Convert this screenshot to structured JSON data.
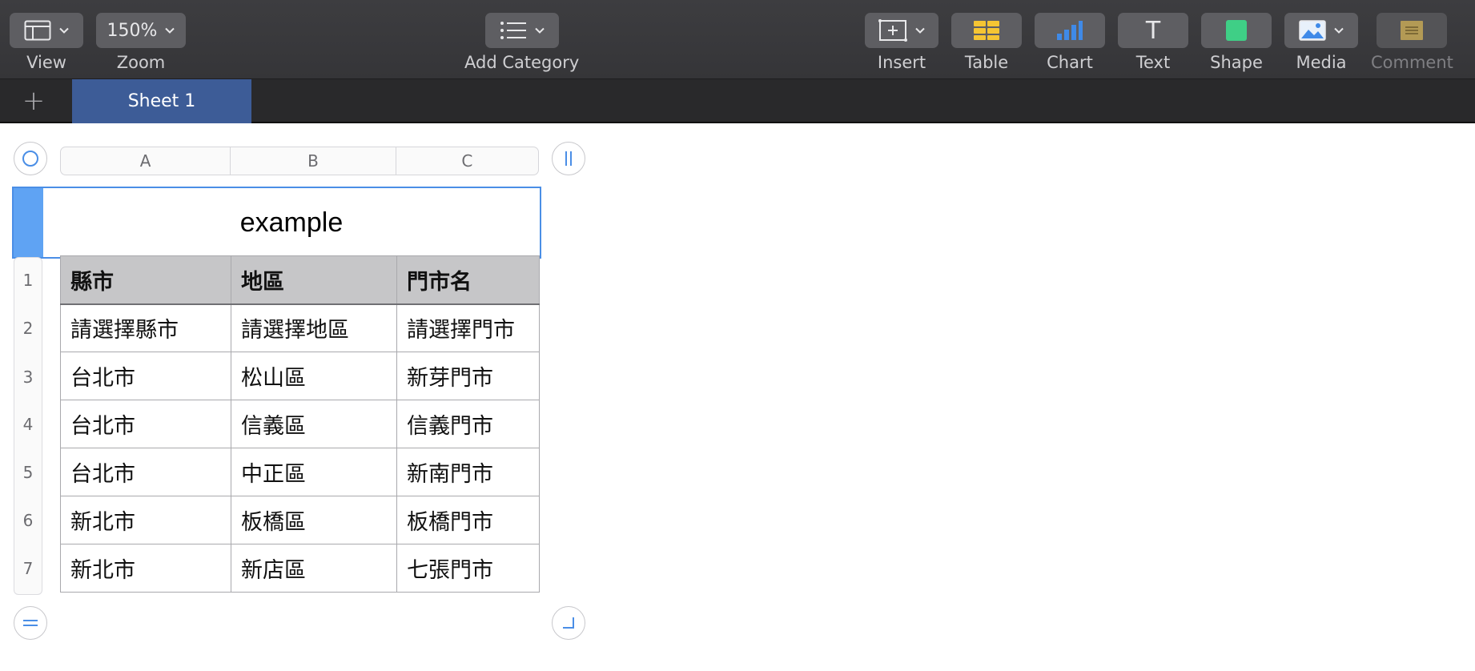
{
  "toolbar": {
    "view": {
      "label": "View"
    },
    "zoom": {
      "value": "150%",
      "label": "Zoom"
    },
    "add_category": {
      "label": "Add Category"
    },
    "insert": {
      "label": "Insert"
    },
    "table": {
      "label": "Table"
    },
    "chart": {
      "label": "Chart"
    },
    "text": {
      "label": "Text",
      "glyph": "T"
    },
    "shape": {
      "label": "Shape"
    },
    "media": {
      "label": "Media"
    },
    "comment": {
      "label": "Comment"
    }
  },
  "tabs": {
    "add_glyph": "+",
    "sheets": [
      {
        "label": "Sheet 1",
        "active": true
      }
    ]
  },
  "table": {
    "title": "example",
    "column_letters": [
      "A",
      "B",
      "C"
    ],
    "row_numbers": [
      "1",
      "2",
      "3",
      "4",
      "5",
      "6",
      "7"
    ],
    "header": [
      "縣市",
      "地區",
      "門市名"
    ],
    "rows": [
      [
        "請選擇縣市",
        "請選擇地區",
        "請選擇門市"
      ],
      [
        "台北市",
        "松山區",
        "新芽門市"
      ],
      [
        "台北市",
        "信義區",
        "信義門市"
      ],
      [
        "台北市",
        "中正區",
        "新南門市"
      ],
      [
        "新北市",
        "板橋區",
        "板橋門市"
      ],
      [
        "新北市",
        "新店區",
        "七張門市"
      ]
    ]
  },
  "colors": {
    "accent": "#4a8ee6",
    "sheet_tab": "#3d5c97",
    "table_icon": "#f5c533",
    "chart_icon": "#3f8ae8",
    "shape_icon": "#3fcf86"
  }
}
